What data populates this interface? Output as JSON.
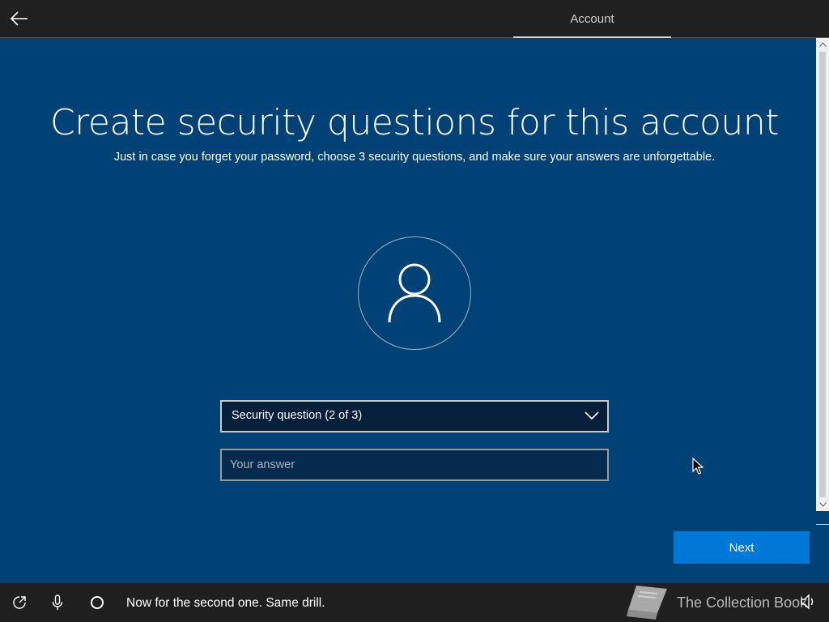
{
  "header": {
    "back_icon": "back-arrow-icon",
    "tab_label": "Account"
  },
  "main": {
    "title": "Create security questions for this account",
    "subtitle": "Just in case you forget your password, choose 3 security questions, and make sure your answers are unforgettable.",
    "avatar_icon": "person-icon",
    "question_select": {
      "selected": "Security question (2 of 3)",
      "icon": "chevron-down-icon"
    },
    "answer_input": {
      "value": "",
      "placeholder": "Your answer"
    },
    "next_label": "Next"
  },
  "footer": {
    "ease_icon": "ease-of-access-icon",
    "mic_icon": "microphone-icon",
    "cortana_icon": "cortana-circle-icon",
    "narration": "Now for the second one. Same drill.",
    "watermark": "The Collection Book",
    "volume_icon": "volume-icon"
  },
  "colors": {
    "background": "#004275",
    "topbar": "#202020",
    "accent_button": "#0078d7",
    "select_bg": "#061f3a"
  }
}
